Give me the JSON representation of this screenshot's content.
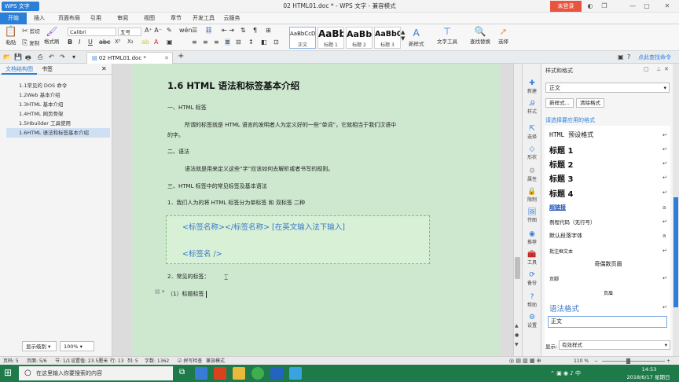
{
  "titlebar": {
    "app_name": "WPS 文字",
    "title": "02 HTML01.doc * - WPS 文字 - 兼容模式",
    "login": "未登录"
  },
  "menu": [
    "开始",
    "插入",
    "页面布局",
    "引用",
    "审阅",
    "视图",
    "章节",
    "开发工具",
    "云服务"
  ],
  "ribbon": {
    "paste": "粘贴",
    "cut": "剪切",
    "copy": "复制",
    "format_painter": "格式刷",
    "font": "Calibri",
    "size": "五号",
    "styles": [
      {
        "preview": "AaBbCcDd",
        "name": "正文"
      },
      {
        "preview": "AaBb",
        "name": "标题 1"
      },
      {
        "preview": "AaBb",
        "name": "标题 2"
      },
      {
        "preview": "AaBbC",
        "name": "标题 3"
      }
    ],
    "new_style": "新样式",
    "text_tools": "文字工具",
    "find_replace": "查找替换",
    "select": "选择"
  },
  "tab": {
    "label": "02 HTML01.doc *"
  },
  "nav": {
    "tab_outline": "文档结构图",
    "tab_bookmark": "书签",
    "items": [
      "1.1常见的 DOS 命令",
      "1.2Web 基本介绍",
      "1.3HTML 基本介绍",
      "1.4HTML 网页骨架",
      "1.5Hbuilder 工具使用",
      "1.6HTML 语法和标签基本介绍"
    ],
    "level_select": "显示级别",
    "zoom_select": "100%"
  },
  "doc": {
    "heading": "1.6 HTML 语法和标签基本介绍",
    "s1": "一、HTML 标签",
    "p1": "所谓的标签就是 HTML 语言的发明者人为定义好的一些“单词”，它就相当于我们汉语中",
    "p1b": "的字。",
    "s2": "二、语法",
    "p2": "语法就是用来定义这些“字”应该如何去解析或者书写的规则。",
    "s3": "三、HTML 标签中的常见标签及基本语法",
    "l1": "1．我们人为的将 HTML 标签分为单标签 和 双标签 二种",
    "code1": "<标签名称></标签名称>  [在英文输入法下输入]",
    "code2": "<标签名 />",
    "l2": "2．常见的标签：",
    "l3": "（1）标题标签"
  },
  "rail": [
    "新建",
    "样式",
    "选择",
    "形状",
    "属性",
    "限制",
    "传图",
    "推荐",
    "工具",
    "备份",
    "帮助",
    "设置"
  ],
  "panel": {
    "title": "样式和格式",
    "current": "正文",
    "new_style_btn": "新样式...",
    "clear_btn": "清除格式",
    "prompt": "请选择要应用的格式",
    "styles": [
      {
        "name": "HTML 预设格式",
        "cls": "mono"
      },
      {
        "name": "标题 1",
        "cls": "h"
      },
      {
        "name": "标题 2",
        "cls": "h"
      },
      {
        "name": "标题 3",
        "cls": "h"
      },
      {
        "name": "标题 4",
        "cls": "h"
      },
      {
        "name": "超链接",
        "cls": "link"
      },
      {
        "name": "例程代码（无行号）",
        "cls": "small"
      },
      {
        "name": "默认段落字体",
        "cls": "small"
      },
      {
        "name": "批注框文本",
        "cls": "tiny"
      },
      {
        "name": "奇偶数页眉",
        "cls": "center"
      },
      {
        "name": "页脚",
        "cls": "tiny"
      },
      {
        "name": "页眉",
        "cls": "center"
      },
      {
        "name": "语法格式",
        "cls": "syntax"
      },
      {
        "name": "正文",
        "cls": "box"
      }
    ],
    "show_label": "显示:",
    "show_value": "有效样式"
  },
  "status": {
    "page": "页码: 5",
    "pages": "页面: 5/6",
    "section": "节: 1/1",
    "setvalue": "设置值: 23.5厘米",
    "row": "行: 13",
    "col": "列: 5",
    "words": "字数: 1362",
    "spell": "拼写检查",
    "compat": "兼容模式",
    "zoom": "110 %"
  },
  "taskbar": {
    "search_placeholder": "在这里输入你要搜索的内容",
    "time": "14:53",
    "date": "2018/6/17 星期日"
  }
}
